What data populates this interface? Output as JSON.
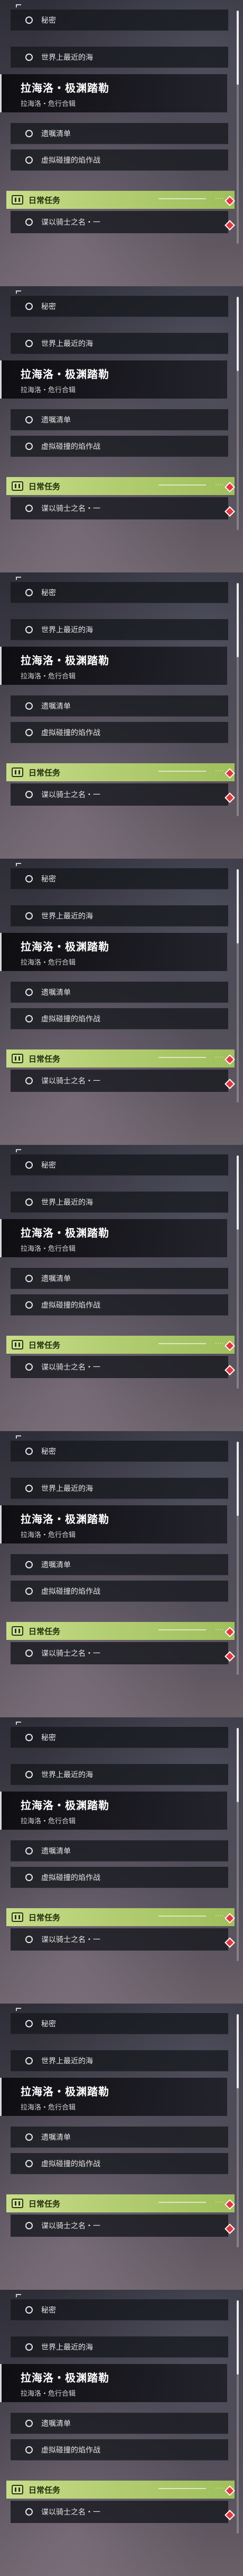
{
  "quest_list": {
    "items": [
      {
        "label": "秘密"
      },
      {
        "label": "世界上最近的海"
      }
    ],
    "region": {
      "title": "拉海洛・极渊踏勒",
      "subtitle": "拉海洛・危行合辑"
    },
    "region_items": [
      {
        "label": "遗嘱清单"
      },
      {
        "label": "虚拟碰撞的焰作战"
      }
    ],
    "daily": {
      "label": "日常任务",
      "task": "谍以骑士之名・一"
    }
  },
  "colors": {
    "daily_accent": "#b3ce72",
    "marker": "#e0373f"
  }
}
